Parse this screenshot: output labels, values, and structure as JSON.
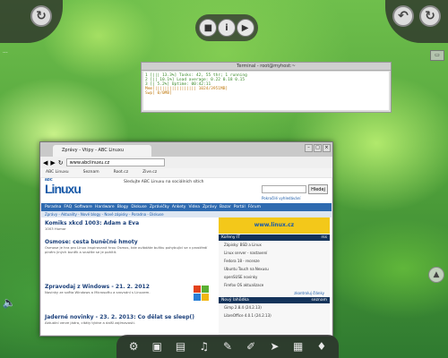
{
  "desktop": {
    "top_left_icon": "refresh-icon",
    "top_right_icons": [
      "back-arrow-icon",
      "refresh-icon"
    ],
    "player_controls": [
      "stop-icon",
      "info-icon",
      "play-icon"
    ],
    "left_small_indicator": "...",
    "volume_icon": "speaker-icon"
  },
  "terminal": {
    "title": "Terminal - root@myhost:~",
    "lines": [
      "1  [|||                  13.3%]   Tasks: 42, 55 thr; 1 running",
      "2  [||                   10.1%]   Load average: 0.22 0.18 0.15",
      "3  [|                     5.2%]   Uptime: 00:42:11",
      "Mem[||||||||||||||||| 1024/3951MB]",
      "Swp[                       0/0MB]"
    ]
  },
  "browser": {
    "tab_title": "Zprávy - Vtipy - ABC Linuxu",
    "url": "www.abclinuxu.cz",
    "bookmarks": [
      "ABC Linuxu",
      "Seznam",
      "Root.cz",
      "Zive.cz"
    ],
    "site": {
      "logo_small": "abc",
      "logo": "Linuxu",
      "header_links": "Sledujte ABC Linuxu na sociálních sítích",
      "search_button": "Hledej",
      "sub_link": "Pokročilé vyhledávání",
      "nav": [
        "Poradna",
        "FAQ",
        "Software",
        "Hardware",
        "Blogy",
        "Diskuse",
        "Zprávičky",
        "Ankety",
        "Videa",
        "Zprávy",
        "Bazar",
        "Portál",
        "Fórum"
      ],
      "nav2": "Zprávy - Aktuality - Nové blogy - Nové zápisky - Poradna - Diskuse",
      "articles": [
        {
          "title": "Komiks xkcd 1003: Adam a Eva",
          "text": "1003 Humor"
        },
        {
          "title": "Osmose: cesta buněčné hmoty",
          "text": "Osmose je hra pro Linux inspirovaná hrou Osmos, kde ovládáte buňku pohybující se v prostředí plném jiných buněk a snažíte se je pohltit."
        },
        {
          "title": "Zpravodaj z Windows - 21. 2. 2012",
          "text": "Novinky ze světa Windows a Microsoftu a srovnání s Linuxem."
        },
        {
          "title": "Jaderné novinky - 23. 2. 2013: Co dělat se sleep()",
          "text": "Aktuální verze jádra, citáty týdne a další zajímavosti."
        }
      ],
      "sidebar": {
        "ad_text": "www.linux.cz",
        "head1": "Kořeny IT",
        "head1_right": "rss",
        "items": [
          "Zápisky: BSD a Linux",
          "Linux server - nastavení",
          "Fedora 18 - recenze",
          "Ubuntu Touch na Nexusu",
          "openSUSE novinky",
          "Firefox OS aktualizace"
        ],
        "link": "zkontroluj články",
        "head2": "Nový lahůdka",
        "head2_right": "seznam",
        "items2": [
          "Gimp 2.8.4 (24.2.13)",
          "LibreOffice 4.0.1 (24.2.13)"
        ]
      }
    }
  },
  "dock": {
    "icons": [
      "system-icon",
      "terminal-icon",
      "files-icon",
      "music-icon",
      "tools-icon",
      "brush-icon",
      "share-icon",
      "calendar-icon",
      "drop-icon"
    ]
  }
}
